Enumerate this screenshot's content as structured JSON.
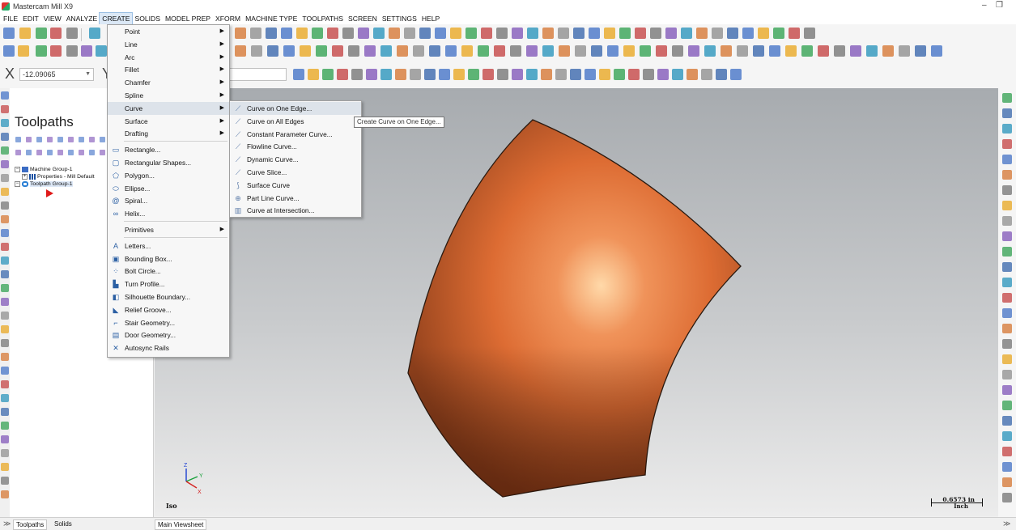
{
  "window": {
    "title": "Mastercam Mill X9",
    "minimize": "–",
    "restore": "❐"
  },
  "menubar": {
    "items": [
      "FILE",
      "EDIT",
      "VIEW",
      "ANALYZE",
      "CREATE",
      "SOLIDS",
      "MODEL PREP",
      "XFORM",
      "MACHINE TYPE",
      "TOOLPATHS",
      "SCREEN",
      "SETTINGS",
      "HELP"
    ],
    "active": "CREATE"
  },
  "autocursor": {
    "x_label": "X",
    "x_value": "-12.09065",
    "y_label": "Y"
  },
  "toolpaths_panel": {
    "title": "Toolpaths",
    "tree": [
      {
        "expander": "−",
        "label": "Machine Group-1"
      },
      {
        "expander": "+",
        "label": "Properties - Mill Default"
      },
      {
        "expander": "−",
        "label": "Toolpath Group-1"
      }
    ]
  },
  "create_menu": {
    "items": [
      {
        "label": "Point",
        "submenu": true,
        "icon": ""
      },
      {
        "label": "Line",
        "submenu": true,
        "icon": ""
      },
      {
        "label": "Arc",
        "submenu": true,
        "icon": ""
      },
      {
        "label": "Fillet",
        "submenu": true,
        "icon": ""
      },
      {
        "label": "Chamfer",
        "submenu": true,
        "icon": ""
      },
      {
        "label": "Spline",
        "submenu": true,
        "icon": ""
      },
      {
        "label": "Curve",
        "submenu": true,
        "icon": "",
        "highlighted": true
      },
      {
        "label": "Surface",
        "submenu": true,
        "icon": ""
      },
      {
        "label": "Drafting",
        "submenu": true,
        "icon": ""
      },
      {
        "separator": true
      },
      {
        "label": "Rectangle...",
        "icon": "rectangle-icon"
      },
      {
        "label": "Rectangular Shapes...",
        "icon": "rounded-rectangle-icon"
      },
      {
        "label": "Polygon...",
        "icon": "polygon-icon"
      },
      {
        "label": "Ellipse...",
        "icon": "ellipse-icon"
      },
      {
        "label": "Spiral...",
        "icon": "spiral-icon"
      },
      {
        "label": "Helix...",
        "icon": "helix-icon"
      },
      {
        "separator": true
      },
      {
        "label": "Primitives",
        "submenu": true,
        "icon": ""
      },
      {
        "separator": true
      },
      {
        "label": "Letters...",
        "icon": "letter-a-icon"
      },
      {
        "label": "Bounding Box...",
        "icon": "bounding-box-icon"
      },
      {
        "label": "Bolt Circle...",
        "icon": "bolt-circle-icon"
      },
      {
        "label": "Turn Profile...",
        "icon": "turn-profile-icon"
      },
      {
        "label": "Silhouette Boundary...",
        "icon": "silhouette-icon"
      },
      {
        "label": "Relief Groove...",
        "icon": "relief-groove-icon"
      },
      {
        "label": "Stair Geometry...",
        "icon": "stair-icon"
      },
      {
        "label": "Door Geometry...",
        "icon": "door-icon"
      },
      {
        "label": "Autosync Rails",
        "icon": "autosync-icon"
      }
    ]
  },
  "curve_submenu": {
    "items": [
      {
        "label": "Curve on One Edge...",
        "highlighted": true
      },
      {
        "label": "Curve on All Edges"
      },
      {
        "label": "Constant Parameter Curve..."
      },
      {
        "label": "Flowline Curve..."
      },
      {
        "label": "Dynamic Curve..."
      },
      {
        "label": "Curve Slice..."
      },
      {
        "label": "Surface Curve"
      },
      {
        "label": "Part Line Curve..."
      },
      {
        "label": "Curve at Intersection..."
      }
    ]
  },
  "tooltip": "Create Curve on One Edge...",
  "viewport": {
    "view_name": "Iso",
    "scale_value": "0.6573 in",
    "scale_unit": "Inch",
    "axis_labels": {
      "z": "Z",
      "y": "Y",
      "x": "X"
    },
    "surface_color": "#d9692f"
  },
  "bottom_tabs": {
    "left": [
      "Toolpaths",
      "Solids"
    ],
    "viewsheet": "Main Viewsheet"
  }
}
